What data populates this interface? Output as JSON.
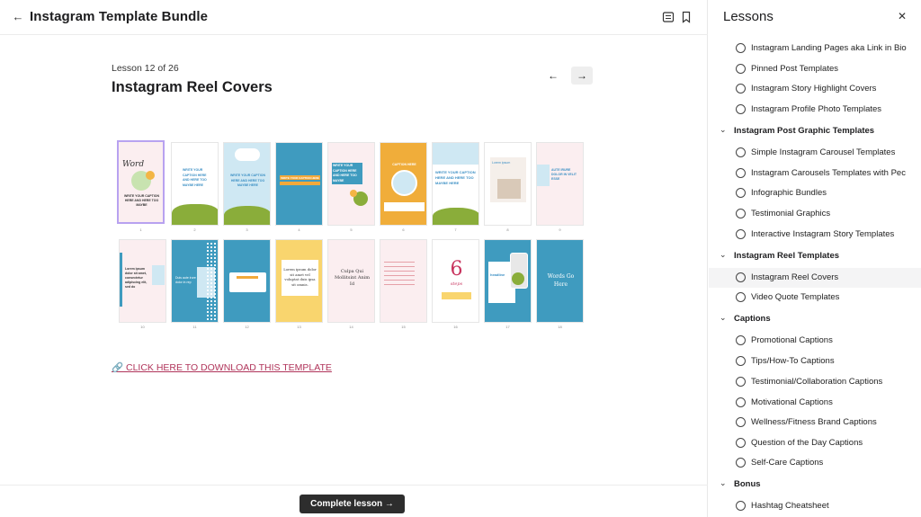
{
  "header": {
    "title": "Instagram Template Bundle",
    "back_icon": "arrow-left-icon",
    "icons": [
      "notes-icon",
      "bookmark-icon"
    ]
  },
  "lesson": {
    "count": "Lesson 12 of 26",
    "title": "Instagram Reel Covers",
    "download_link": "🔗 CLICK HERE TO DOWNLOAD THIS TEMPLATE",
    "complete_label": "Complete lesson →"
  },
  "template_grid": {
    "row1_numbers": [
      "1",
      "2",
      "3",
      "4",
      "5",
      "6",
      "7",
      "8",
      "9"
    ],
    "row2_numbers": [
      "10",
      "11",
      "12",
      "13",
      "14",
      "15",
      "16",
      "17",
      "18"
    ],
    "tiles": [
      {
        "texts": [
          "Word",
          "WRITE YOUR CAPTION HERE AND HERE TOO MAYBE"
        ]
      },
      {
        "texts": [
          "WRITE YOUR CAPTION HERE AND HERE TOO MAYBE HERE"
        ]
      },
      {
        "texts": [
          "WRITE YOUR CAPTION HERE AND HERE TOO MAYBE HERE"
        ]
      },
      {
        "texts": [
          "WRITE YOUR CAPTION HERE"
        ]
      },
      {
        "texts": [
          "WRITE YOUR CAPTION HERE AND HERE TOO MAYBE"
        ]
      },
      {
        "texts": [
          "CAPTION HERE"
        ]
      },
      {
        "texts": [
          "WRITE YOUR CAPTION HERE AND HERE TOO MAYBE HERE"
        ]
      },
      {
        "texts": [
          "Lorem ipsum"
        ]
      },
      {
        "texts": [
          "AUTE IRURE DOLOR IN VELIT ESSE"
        ]
      },
      {
        "texts": [
          "Lorem ipsum dolor sit amet, consectetur adipiscing elit, sed do"
        ]
      },
      {
        "texts": [
          "Duis aute irure dolor in rep"
        ]
      },
      {
        "texts": []
      },
      {
        "texts": [
          "Lorem ipsum dolor sit amet vel voluptat duis ipsa sit omnis."
        ]
      },
      {
        "texts": [
          "Culpa Qui Mollitsint Anim Id"
        ]
      },
      {
        "texts": []
      },
      {
        "texts": [
          "6",
          "steps"
        ]
      },
      {
        "texts": [
          "headline"
        ]
      },
      {
        "texts": [
          "Words Go Here"
        ]
      }
    ]
  },
  "sidebar": {
    "title": "Lessons",
    "close_icon": "close-icon",
    "rows": [
      {
        "type": "item",
        "label": "Instagram Landing Pages aka Link in Bio"
      },
      {
        "type": "item",
        "label": "Pinned Post Templates"
      },
      {
        "type": "item",
        "label": "Instagram Story Highlight Covers"
      },
      {
        "type": "item",
        "label": "Instagram Profile Photo Templates"
      },
      {
        "type": "section",
        "label": "Instagram Post Graphic Templates"
      },
      {
        "type": "item",
        "label": "Simple Instagram Carousel Templates"
      },
      {
        "type": "item",
        "label": "Instagram Carousels Templates with Pec"
      },
      {
        "type": "item",
        "label": "Infographic Bundles"
      },
      {
        "type": "item",
        "label": "Testimonial Graphics"
      },
      {
        "type": "item",
        "label": "Interactive Instagram Story Templates"
      },
      {
        "type": "section",
        "label": "Instagram Reel Templates"
      },
      {
        "type": "item",
        "label": "Instagram Reel Covers",
        "active": true
      },
      {
        "type": "item",
        "label": "Video Quote Templates"
      },
      {
        "type": "section",
        "label": "Captions"
      },
      {
        "type": "item",
        "label": "Promotional Captions"
      },
      {
        "type": "item",
        "label": "Tips/How-To Captions"
      },
      {
        "type": "item",
        "label": "Testimonial/Collaboration Captions"
      },
      {
        "type": "item",
        "label": "Motivational Captions"
      },
      {
        "type": "item",
        "label": "Wellness/Fitness Brand Captions"
      },
      {
        "type": "item",
        "label": "Question of the Day Captions"
      },
      {
        "type": "item",
        "label": "Self-Care Captions"
      },
      {
        "type": "section",
        "label": "Bonus"
      },
      {
        "type": "item",
        "label": "Hashtag Cheatsheet"
      }
    ]
  }
}
